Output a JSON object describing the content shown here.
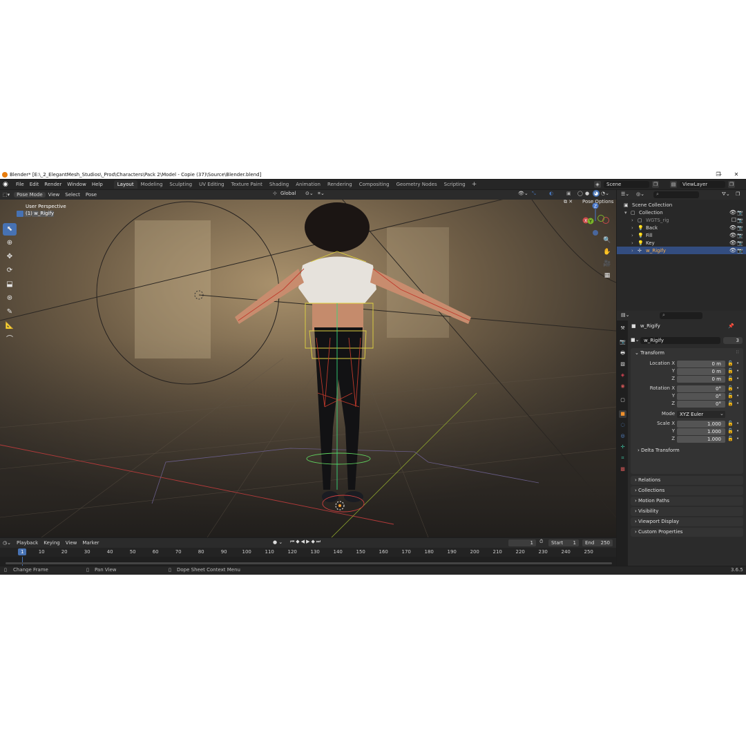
{
  "window": {
    "title": "Blender* [E:\\_2_ElegantMesh_Studios\\_Prod\\Characters\\Pack 2\\Model - Copie (37)\\Source\\Blender.blend]",
    "controls": [
      "—",
      "❐",
      "✕"
    ]
  },
  "menubar": {
    "menus": [
      "File",
      "Edit",
      "Render",
      "Window",
      "Help"
    ],
    "workspaces": [
      "Layout",
      "Modeling",
      "Sculpting",
      "UV Editing",
      "Texture Paint",
      "Shading",
      "Animation",
      "Rendering",
      "Compositing",
      "Geometry Nodes",
      "Scripting"
    ],
    "active_workspace": "Layout",
    "add_label": "+",
    "scene": "Scene",
    "view_layer": "ViewLayer"
  },
  "viewport": {
    "mode": "Pose Mode",
    "menus": [
      "View",
      "Select",
      "Pose"
    ],
    "orientation": "Global",
    "overlay_label": "User Perspective",
    "active_object": "(1) w_Rigify",
    "pose_options": "Pose Options",
    "tools": [
      "select-box",
      "cursor",
      "move",
      "rotate",
      "scale",
      "transform",
      "annotate",
      "measure",
      "bone-envelope"
    ]
  },
  "timeline": {
    "menus": [
      "Playback",
      "Keying",
      "View",
      "Marker"
    ],
    "current_frame": "1",
    "start_label": "Start",
    "start": "1",
    "end_label": "End",
    "end": "250",
    "ruler_current": "1",
    "ruler": [
      "10",
      "20",
      "30",
      "40",
      "50",
      "60",
      "70",
      "80",
      "90",
      "100",
      "110",
      "120",
      "130",
      "140",
      "150",
      "160",
      "170",
      "180",
      "190",
      "200",
      "210",
      "220",
      "230",
      "240",
      "250"
    ]
  },
  "statusbar": {
    "left": "Change Frame",
    "middle": "Pan View",
    "right": "Dope Sheet Context Menu",
    "version": "3.6.5"
  },
  "outliner": {
    "rows": [
      {
        "label": "Scene Collection",
        "indent": 0,
        "icon": "scene-collection-icon"
      },
      {
        "label": "Collection",
        "indent": 1,
        "icon": "collection-icon"
      },
      {
        "label": "WGTS_rig",
        "indent": 2,
        "icon": "collection-icon",
        "dim": true
      },
      {
        "label": "Back",
        "indent": 2,
        "icon": "light-icon"
      },
      {
        "label": "Fill",
        "indent": 2,
        "icon": "light-icon"
      },
      {
        "label": "Key",
        "indent": 2,
        "icon": "light-icon"
      },
      {
        "label": "w_Rigify",
        "indent": 2,
        "icon": "armature-icon",
        "selected": true
      }
    ]
  },
  "properties": {
    "object_name": "w_Rigify",
    "datablock": "w_Rigify",
    "users": "3",
    "transform_title": "Transform",
    "location": {
      "label_x": "Location X",
      "label_y": "Y",
      "label_z": "Z",
      "x": "0 m",
      "y": "0 m",
      "z": "0 m"
    },
    "rotation": {
      "label_x": "Rotation X",
      "label_y": "Y",
      "label_z": "Z",
      "x": "0°",
      "y": "0°",
      "z": "0°"
    },
    "mode_label": "Mode",
    "mode": "XYZ Euler",
    "scale": {
      "label_x": "Scale X",
      "label_y": "Y",
      "label_z": "Z",
      "x": "1.000",
      "y": "1.000",
      "z": "1.000"
    },
    "delta": "Delta Transform",
    "panels": [
      "Relations",
      "Collections",
      "Motion Paths",
      "Visibility",
      "Viewport Display",
      "Custom Properties"
    ]
  },
  "colors": {
    "accent": "#4772b3",
    "selection_text": "#ffb44d",
    "bg": "#1d1d1d"
  }
}
